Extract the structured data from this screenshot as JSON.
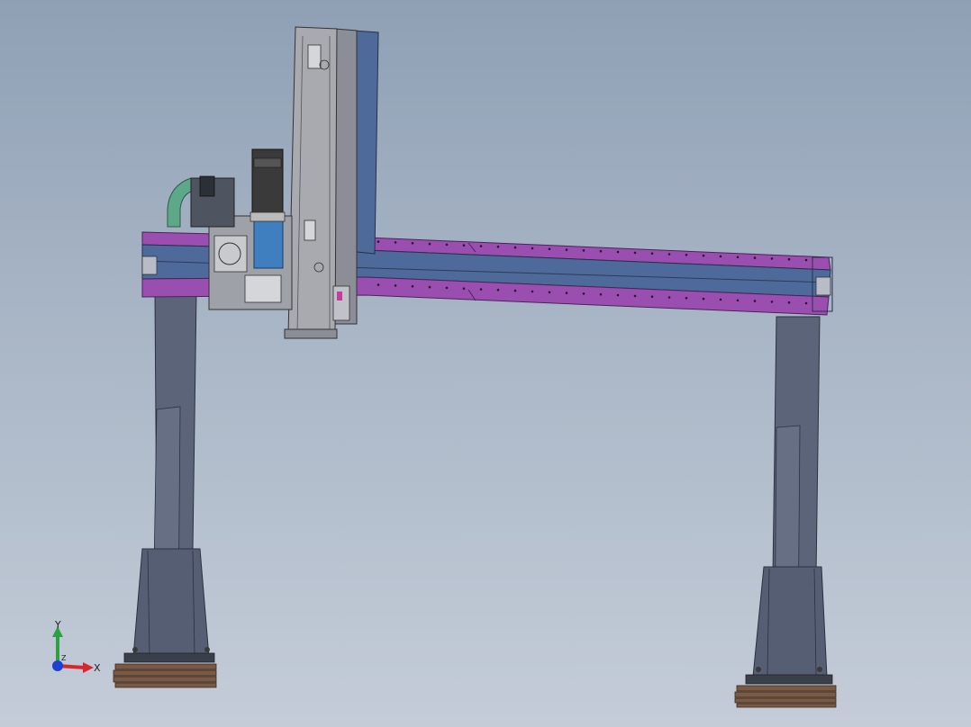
{
  "viewport": {
    "background_top": "#8fa0b5",
    "background_bottom": "#c4ccd8"
  },
  "colors": {
    "beam_purple": "#9a4fb0",
    "beam_blue": "#4e6a9a",
    "leg_gray": "#5b6478",
    "column_gray": "#a8aab0",
    "motor_blue": "#3f7fc0",
    "hose_green": "#5ea88a",
    "base_wood": "#7a5a44"
  },
  "triad": {
    "x_label": "X",
    "y_label": "Y",
    "z_label": "Z",
    "x_color": "#d8262e",
    "y_color": "#2ea043",
    "z_color": "#1f3fd1",
    "icons": [
      "x-axis-arrow-icon",
      "y-axis-arrow-icon",
      "z-axis-origin-icon"
    ]
  }
}
